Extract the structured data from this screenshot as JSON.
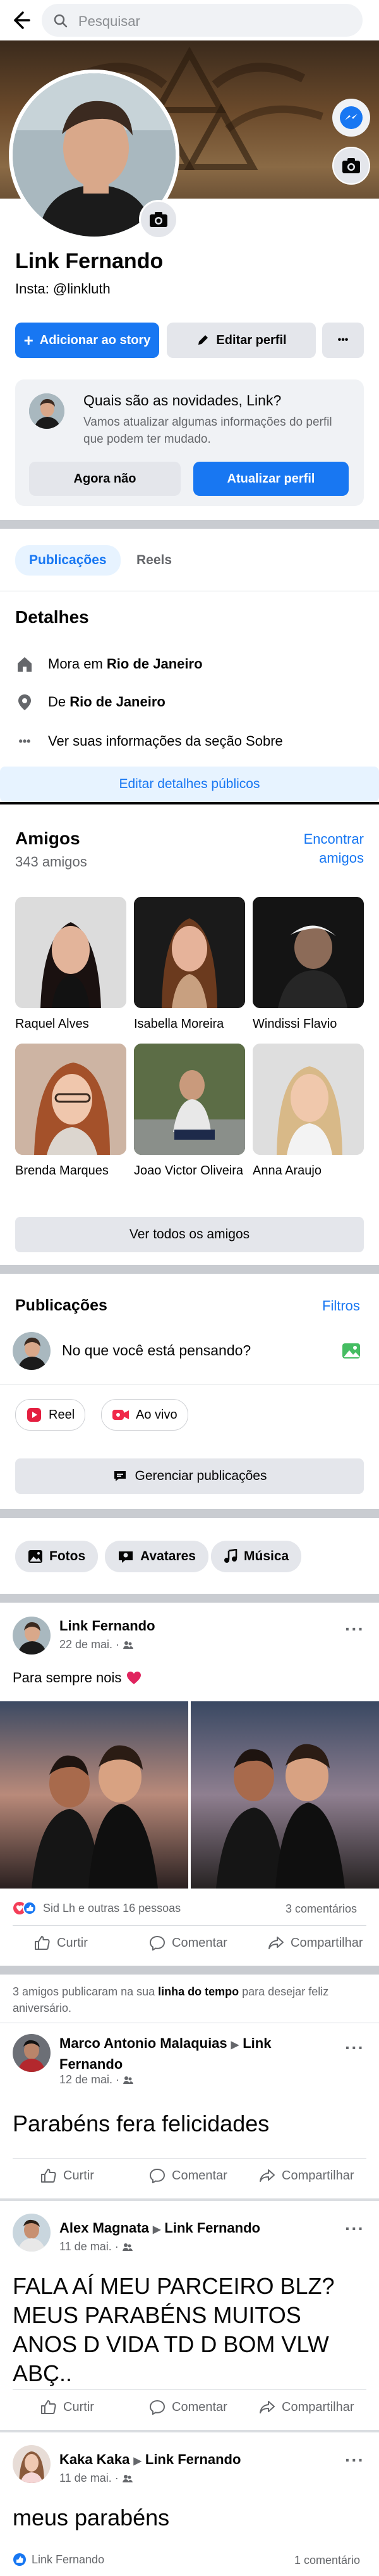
{
  "search": {
    "placeholder": "Pesquisar"
  },
  "profile": {
    "name": "Link Fernando",
    "insta": "Insta: @linkluth",
    "buttons": {
      "add_story": "Adicionar ao story",
      "edit_profile": "Editar perfil",
      "more": "•••"
    }
  },
  "update_prompt": {
    "title": "Quais são as novidades, Link?",
    "subtitle": "Vamos atualizar algumas informações do perfil que podem ter mudado.",
    "later": "Agora não",
    "update": "Atualizar perfil"
  },
  "tabs": [
    "Publicações",
    "Reels"
  ],
  "details": {
    "heading": "Detalhes",
    "lives_prefix": "Mora em ",
    "lives_city": "Rio de Janeiro",
    "from_prefix": "De ",
    "from_city": "Rio de Janeiro",
    "about": "Ver suas informações da seção Sobre",
    "edit": "Editar detalhes públicos"
  },
  "friends": {
    "heading": "Amigos",
    "count": "343 amigos",
    "find_line1": "Encontrar",
    "find_line2": "amigos",
    "list": [
      {
        "name": "Raquel Alves"
      },
      {
        "name": "Isabella Moreira"
      },
      {
        "name": "Windissi Flavio"
      },
      {
        "name": "Brenda Marques"
      },
      {
        "name": "Joao Victor Oliveira"
      },
      {
        "name": "Anna Araujo"
      }
    ],
    "see_all": "Ver todos os amigos"
  },
  "publications": {
    "heading": "Publicações",
    "filters": "Filtros",
    "composer": "No que você está pensando?",
    "reel": "Reel",
    "live": "Ao vivo",
    "manage": "Gerenciar publicações"
  },
  "media_chips": [
    "Fotos",
    "Avatares",
    "Música"
  ],
  "post": {
    "author": "Link Fernando",
    "date": "22 de mai. ·",
    "text": "Para sempre nois",
    "reactions": "Sid Lh e outras 16 pessoas",
    "comments": "3 comentários"
  },
  "actions": {
    "like": "Curtir",
    "comment": "Comentar",
    "share": "Compartilhar"
  },
  "timeline_note": {
    "before": "3 amigos publicaram na sua ",
    "bold": "linha do tempo",
    "after": " para desejar feliz aniversário."
  },
  "wall_posts": [
    {
      "author": "Marco Antonio Malaquias",
      "target": "Link Fernando",
      "date": "12 de mai. ·",
      "text": "Parabéns fera felicidades"
    },
    {
      "author": "Alex Magnata",
      "target": "Link Fernando",
      "date": "11 de mai. ·",
      "text": "FALA AÍ MEU PARCEIRO BLZ? MEUS PARABÉNS MUITOS ANOS D VIDA TD D BOM VLW ABÇ.."
    },
    {
      "author": "Kaka Kaka",
      "target": "Link Fernando",
      "date": "11 de mai. ·",
      "text": "meus parabéns",
      "footer_name": "Link Fernando",
      "footer_comments": "1 comentário"
    }
  ],
  "colors": {
    "accent": "#1877f2",
    "bg_gray": "#f0f2f5",
    "separator": "#c9ccd1"
  }
}
